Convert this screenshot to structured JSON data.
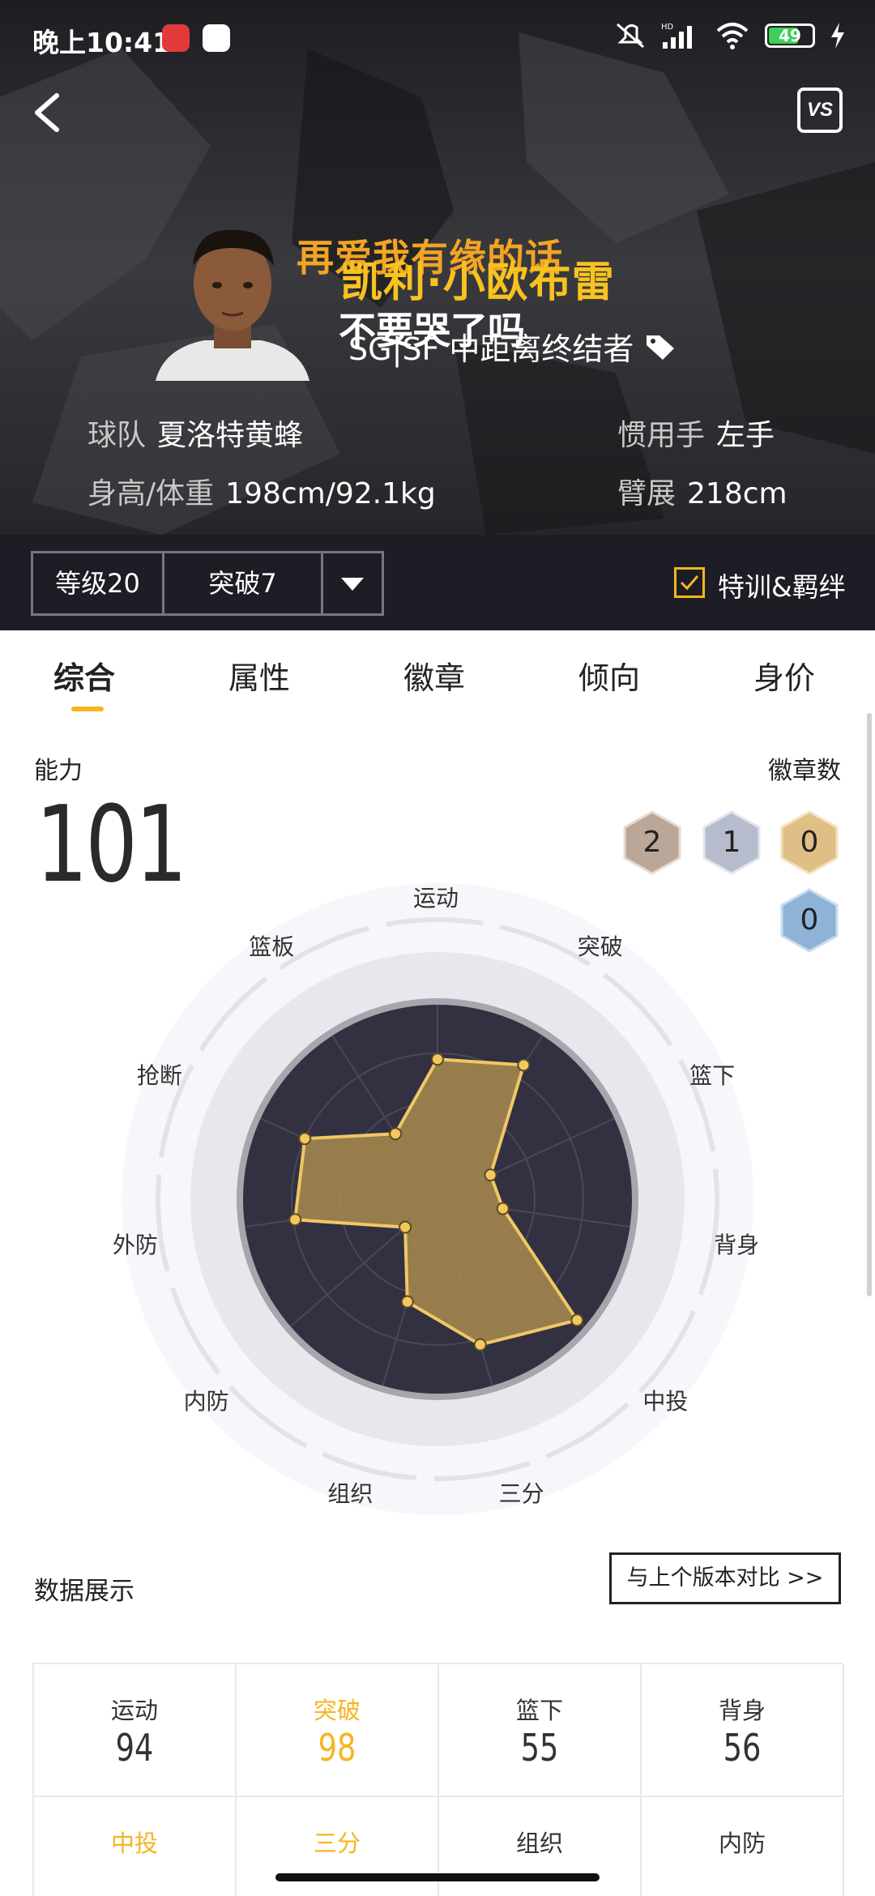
{
  "status_bar": {
    "time": "晚上10:41",
    "battery": "49"
  },
  "player": {
    "name": "凯利·小欧布雷",
    "position_line": "SG|SF 中距离终结者",
    "team_label": "球队",
    "team": "夏洛特黄蜂",
    "hand_label": "惯用手",
    "hand": "左手",
    "size_label": "身高/体重",
    "size": "198cm/92.1kg",
    "wingspan_label": "臂展",
    "wingspan": "218cm"
  },
  "lyrics": {
    "line1": "再爱我有缘的话",
    "line2": "不要哭了吗"
  },
  "vs_label": "VS",
  "filter_bar": {
    "level": "等级20",
    "breakthrough": "突破7",
    "training_label": "特训&羁绊",
    "training_checked": true
  },
  "tabs": [
    "综合",
    "属性",
    "徽章",
    "倾向",
    "身价"
  ],
  "active_tab": "综合",
  "ability": {
    "label": "能力",
    "value": "101"
  },
  "badges": {
    "label": "徽章数",
    "counts": [
      {
        "tier": "bronze",
        "count": "2",
        "color": "#bba797"
      },
      {
        "tier": "silver",
        "count": "1",
        "color": "#b6bccb"
      },
      {
        "tier": "gold",
        "count": "0",
        "color": "#dfbf86"
      },
      {
        "tier": "hof",
        "count": "0",
        "color": "#8fb3d7"
      }
    ]
  },
  "radar": {
    "axes": [
      "运动",
      "突破",
      "篮下",
      "背身",
      "中投",
      "三分",
      "组织",
      "内防",
      "外防",
      "抢断",
      "篮板"
    ],
    "values": [
      0.72,
      0.82,
      0.3,
      0.34,
      0.95,
      0.78,
      0.55,
      0.22,
      0.74,
      0.75,
      0.4
    ],
    "fill_color": "#a88b4e",
    "line_color": "#f0c766",
    "bg_color": "#323041"
  },
  "data_section": {
    "title": "数据展示",
    "compare_label": "与上个版本对比 >>",
    "stats": [
      {
        "name": "运动",
        "value": "94",
        "highlight": false
      },
      {
        "name": "突破",
        "value": "98",
        "highlight": true
      },
      {
        "name": "篮下",
        "value": "55",
        "highlight": false
      },
      {
        "name": "背身",
        "value": "56",
        "highlight": false
      },
      {
        "name": "中投",
        "value": "",
        "highlight": true
      },
      {
        "name": "三分",
        "value": "",
        "highlight": true
      },
      {
        "name": "组织",
        "value": "",
        "highlight": false
      },
      {
        "name": "内防",
        "value": "",
        "highlight": false
      }
    ]
  }
}
